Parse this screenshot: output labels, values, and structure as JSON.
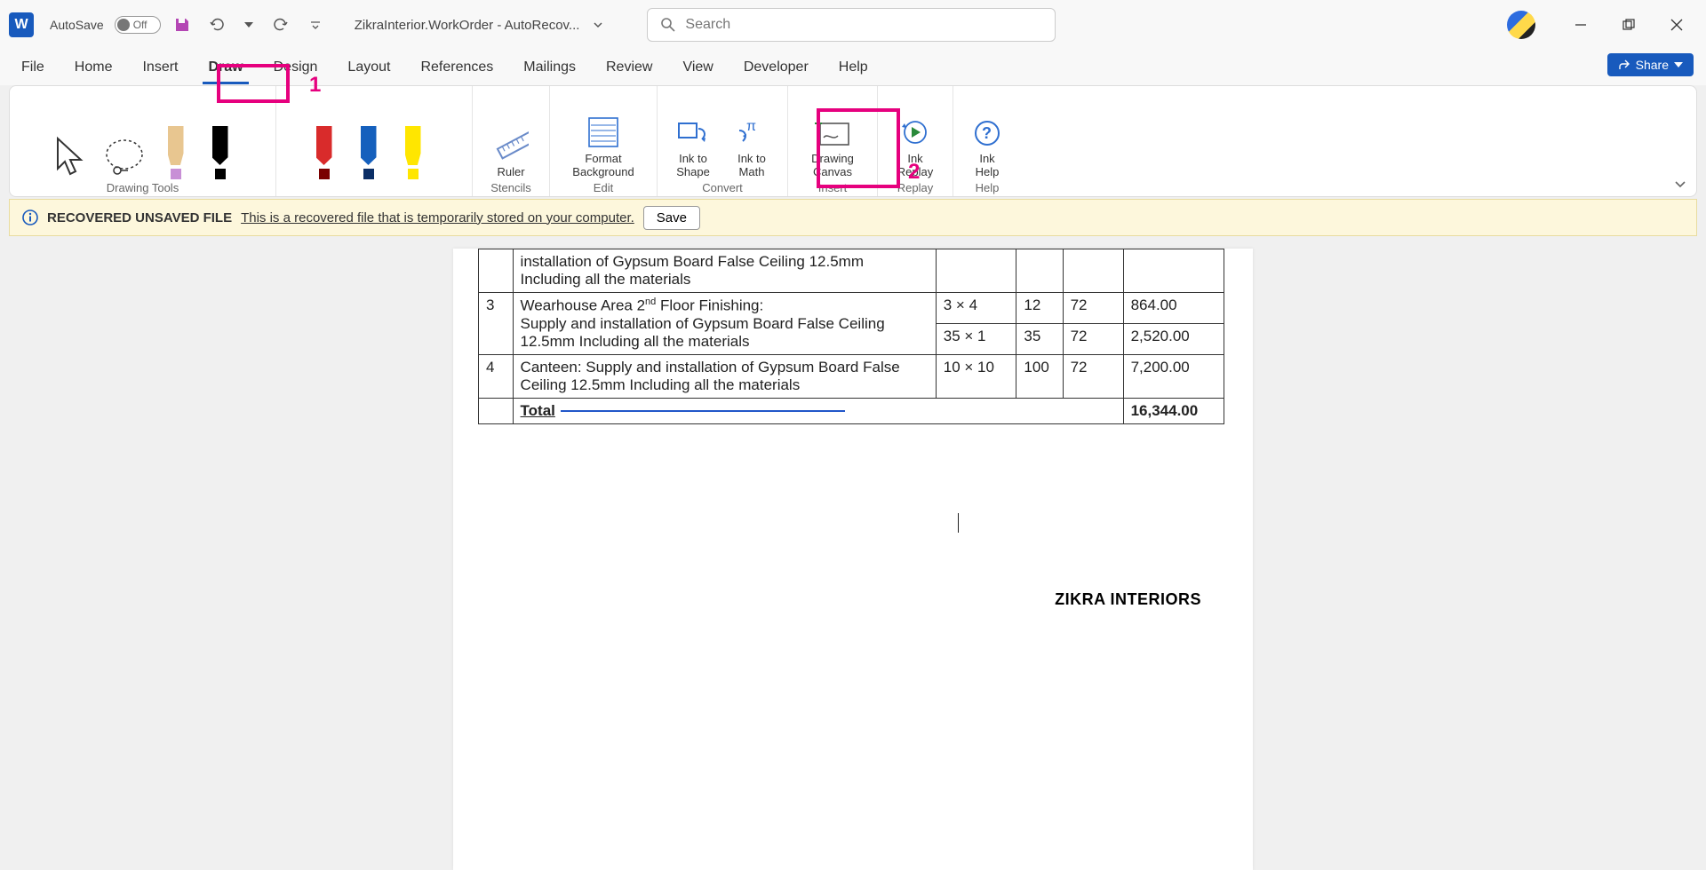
{
  "titlebar": {
    "autosave_label": "AutoSave",
    "autosave_state": "Off",
    "doc_name": "ZikraInterior.WorkOrder",
    "doc_suffix": " - AutoRecov...",
    "search_placeholder": "Search"
  },
  "tabs": {
    "items": [
      "File",
      "Home",
      "Insert",
      "Draw",
      "Design",
      "Layout",
      "References",
      "Mailings",
      "Review",
      "View",
      "Developer",
      "Help"
    ],
    "active_index": 3,
    "share_label": "Share"
  },
  "ribbon": {
    "groups": {
      "drawing_tools": {
        "label": "Drawing Tools"
      },
      "stencils": {
        "label": "Stencils",
        "ruler": "Ruler"
      },
      "edit": {
        "label": "Edit",
        "format_bg": "Format\nBackground"
      },
      "convert": {
        "label": "Convert",
        "ink_shape": "Ink to\nShape",
        "ink_math": "Ink to\nMath"
      },
      "insert": {
        "label": "Insert",
        "drawing_canvas": "Drawing\nCanvas"
      },
      "replay": {
        "label": "Replay",
        "ink_replay": "Ink\nReplay"
      },
      "help": {
        "label": "Help",
        "ink_help": "Ink\nHelp"
      }
    }
  },
  "callouts": {
    "c1": "1",
    "c2": "2"
  },
  "messagebar": {
    "bold": "RECOVERED UNSAVED FILE",
    "text": "This is a recovered file that is temporarily stored on your computer.",
    "save": "Save"
  },
  "document": {
    "rows": [
      {
        "no": "",
        "desc_a": "installation of Gypsum Board False Ceiling 12.5mm Including all the materials",
        "dim": "",
        "qty": "",
        "rate": "",
        "amt": ""
      },
      {
        "no": "3",
        "desc_a": "Wearhouse Area 2",
        "desc_sup": "nd",
        "desc_b": " Floor Finishing:",
        "desc_c": "Supply and installation of Gypsum Board False Ceiling 12.5mm Including all the materials",
        "dim1": "3 × 4",
        "qty1": "12",
        "rate1": "72",
        "amt1": "864.00",
        "dim2": "35 × 1",
        "qty2": "35",
        "rate2": "72",
        "amt2": "2,520.00"
      },
      {
        "no": "4",
        "desc": "Canteen: Supply and installation of Gypsum Board False Ceiling 12.5mm Including all the materials",
        "dim": "10 × 10",
        "qty": "100",
        "rate": "72",
        "amt": "7,200.00"
      }
    ],
    "total_label": "Total",
    "total_value": "16,344.00",
    "company": "ZIKRA INTERIORS"
  }
}
